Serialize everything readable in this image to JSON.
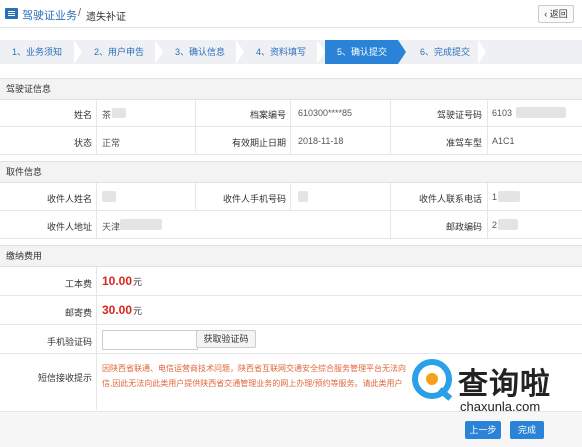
{
  "header": {
    "module_title": "驾驶证业务",
    "separator": "/",
    "sub_title": "遗失补证",
    "back_label": "返回",
    "back_chevron": "‹"
  },
  "steps": [
    {
      "label": "1、业务须知",
      "active": false
    },
    {
      "label": "2、用户申告",
      "active": false
    },
    {
      "label": "3、确认信息",
      "active": false
    },
    {
      "label": "4、资料填写",
      "active": false
    },
    {
      "label": "5、确认提交",
      "active": true
    },
    {
      "label": "6、完成提交",
      "active": false
    }
  ],
  "license_info": {
    "section_title": "驾驶证信息",
    "name_label": "姓名",
    "name_value": "茶",
    "file_no_label": "档案编号",
    "file_no_value": "610300****85",
    "license_no_label": "驾驶证号码",
    "license_no_value": "6103",
    "status_label": "状态",
    "status_value": "正常",
    "expiry_label": "有效期止日期",
    "expiry_value": "2018-11-18",
    "vehicle_type_label": "准驾车型",
    "vehicle_type_value": "A1C1"
  },
  "pickup_info": {
    "section_title": "取件信息",
    "recipient_name_label": "收件人姓名",
    "recipient_phone_label": "收件人手机号码",
    "contact_phone_label": "收件人联系电话",
    "contact_phone_value": "1",
    "address_label": "收件人地址",
    "address_value": "天津",
    "postcode_label": "邮政编码",
    "postcode_value": "2"
  },
  "fees": {
    "section_title": "缴纳费用",
    "production_fee_label": "工本费",
    "production_fee_value": "10.00",
    "postage_label": "邮寄费",
    "postage_value": "30.00",
    "currency_unit": "元",
    "sms_code_label": "手机验证码",
    "sms_code_value": "",
    "get_code_button": "获取验证码",
    "sms_notice_label": "短信接收提示",
    "sms_notice_line1": "因陕西省联通、电信运营商技术问题，陕西省互联网交通安全综合服务管理平台无法向",
    "sms_notice_line2": "信,因此无法向此类用户提供陕西省交通管理业务的网上办理/预约等服务。请此类用户"
  },
  "actions": {
    "prev_label": "上一步",
    "finish_label": "完成"
  },
  "watermark": {
    "cn_text": "查询啦",
    "en_text": "chaxunla.com",
    "icon": "magnifier-logo-icon"
  },
  "colors": {
    "accent": "#2a83d6",
    "link": "#2a6fba",
    "money": "#d9261c",
    "notice": "#e0663a"
  }
}
